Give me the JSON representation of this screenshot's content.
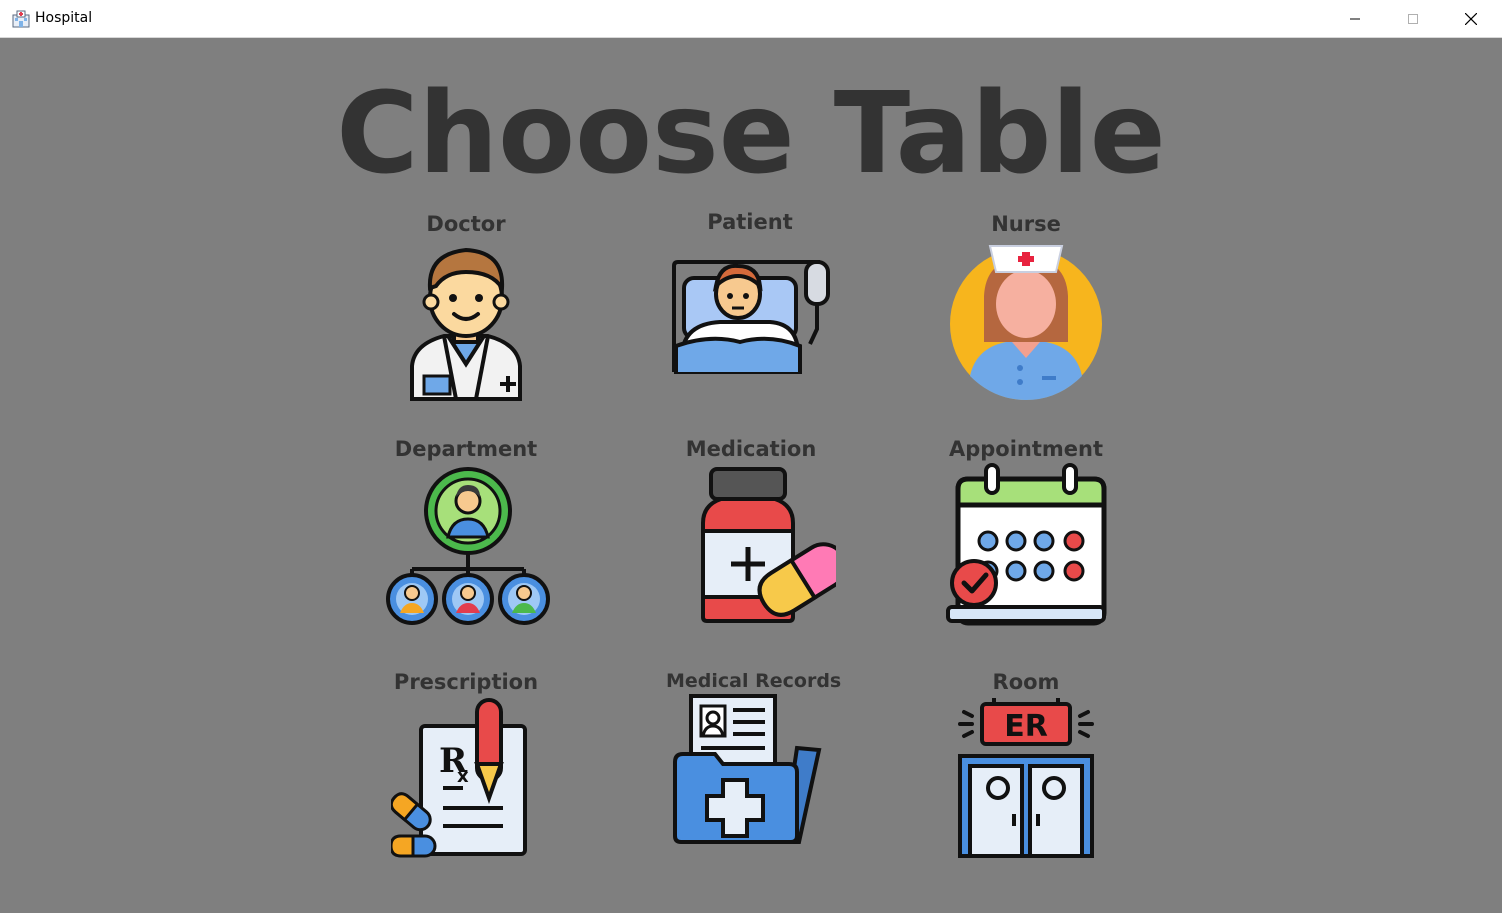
{
  "window": {
    "title": "Hospital",
    "icon": "hospital-icon",
    "controls": [
      "minimize-icon",
      "maximize-icon",
      "close-icon"
    ]
  },
  "main": {
    "heading": "Choose Table",
    "tiles": [
      {
        "label": "Doctor",
        "icon": "doctor-icon"
      },
      {
        "label": "Patient",
        "icon": "patient-bed-icon"
      },
      {
        "label": "Nurse",
        "icon": "nurse-icon"
      },
      {
        "label": "Department",
        "icon": "department-hierarchy-icon"
      },
      {
        "label": "Medication",
        "icon": "medication-bottle-icon"
      },
      {
        "label": "Appointment",
        "icon": "appointment-calendar-icon"
      },
      {
        "label": "Prescription",
        "icon": "prescription-icon"
      },
      {
        "label": "Medical Records",
        "icon": "medical-records-folder-icon"
      },
      {
        "label": "Room",
        "icon": "er-room-icon"
      }
    ]
  },
  "colors": {
    "background": "#7f7f7f",
    "heading": "#333333",
    "titlebar": "#ffffff"
  }
}
